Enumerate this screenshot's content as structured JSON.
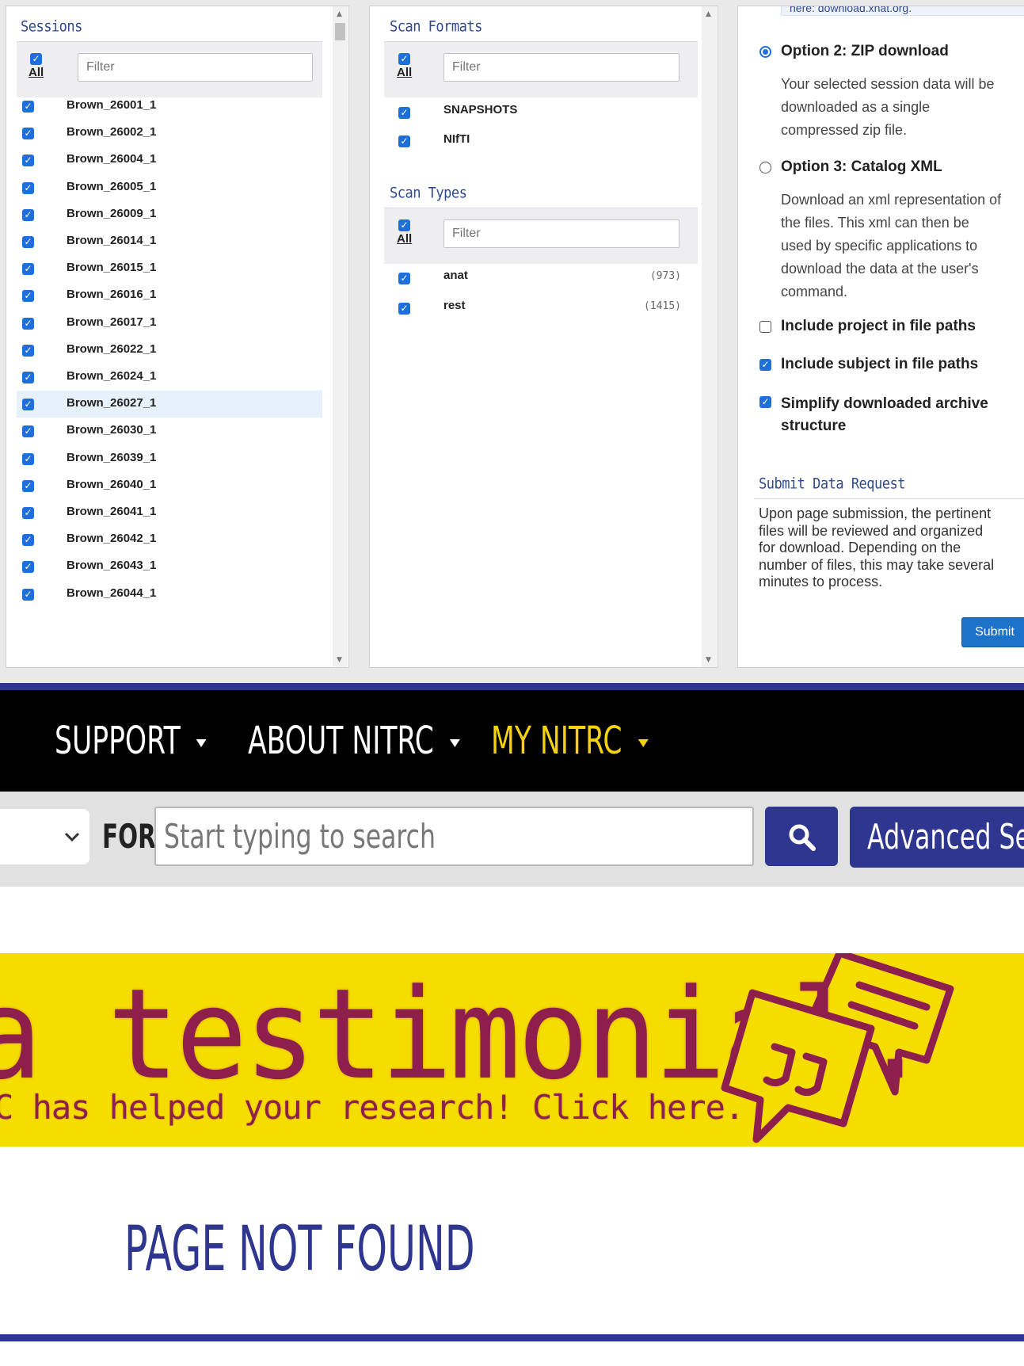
{
  "sessions": {
    "title": "Sessions",
    "all_label": "All",
    "filter_placeholder": "Filter",
    "items": [
      "Brown_26001_1",
      "Brown_26002_1",
      "Brown_26004_1",
      "Brown_26005_1",
      "Brown_26009_1",
      "Brown_26014_1",
      "Brown_26015_1",
      "Brown_26016_1",
      "Brown_26017_1",
      "Brown_26022_1",
      "Brown_26024_1",
      "Brown_26027_1",
      "Brown_26030_1",
      "Brown_26039_1",
      "Brown_26040_1",
      "Brown_26041_1",
      "Brown_26042_1",
      "Brown_26043_1",
      "Brown_26044_1"
    ],
    "selected_item": "Brown_26027_1"
  },
  "scan_formats": {
    "title": "Scan Formats",
    "all_label": "All",
    "filter_placeholder": "Filter",
    "items": [
      "SNAPSHOTS",
      "NIfTI"
    ]
  },
  "scan_types": {
    "title": "Scan Types",
    "all_label": "All",
    "filter_placeholder": "Filter",
    "items": [
      {
        "label": "anat",
        "count": "(973)"
      },
      {
        "label": "rest",
        "count": "(1415)"
      }
    ]
  },
  "download_options": {
    "top_fragment": "here: download.xnat.org.",
    "option2": {
      "label": "Option 2: ZIP download",
      "desc_lines": [
        "Your selected session data will be",
        "downloaded as a single",
        "compressed zip file."
      ],
      "selected": true
    },
    "option3": {
      "label": "Option 3: Catalog XML",
      "desc_lines": [
        "Download an xml representation of",
        "the files. This xml can then be",
        "used by specific applications to",
        "download the data at the user's",
        "command."
      ],
      "selected": false
    },
    "include_project": {
      "label": "Include project in file paths",
      "checked": false
    },
    "include_subject": {
      "label": "Include subject in file paths",
      "checked": true
    },
    "simplify": {
      "label_lines": [
        "Simplify downloaded archive",
        "structure"
      ],
      "checked": true
    }
  },
  "submit_section": {
    "title": "Submit Data Request",
    "text_lines": [
      "Upon page submission, the pertinent",
      "files will be reviewed and organized",
      "for download. Depending on the",
      "number of files, this may take several",
      "minutes to process."
    ],
    "button_label": "Submit"
  },
  "nav": {
    "items": [
      "SUPPORT",
      "ABOUT NITRC",
      "MY NITRC"
    ],
    "active_color": "#f5d20d",
    "bar_color": "#2e3690"
  },
  "search": {
    "for_label": "FOR",
    "placeholder": "Start typing to search",
    "advanced_label": "Advanced Sea"
  },
  "banner": {
    "headline": "a testimonial.",
    "subline": "C has helped your research! Click here.",
    "bg_color": "#f6dd00",
    "text_color": "#8e1f4d"
  },
  "page_title": "PAGE NOT FOUND"
}
